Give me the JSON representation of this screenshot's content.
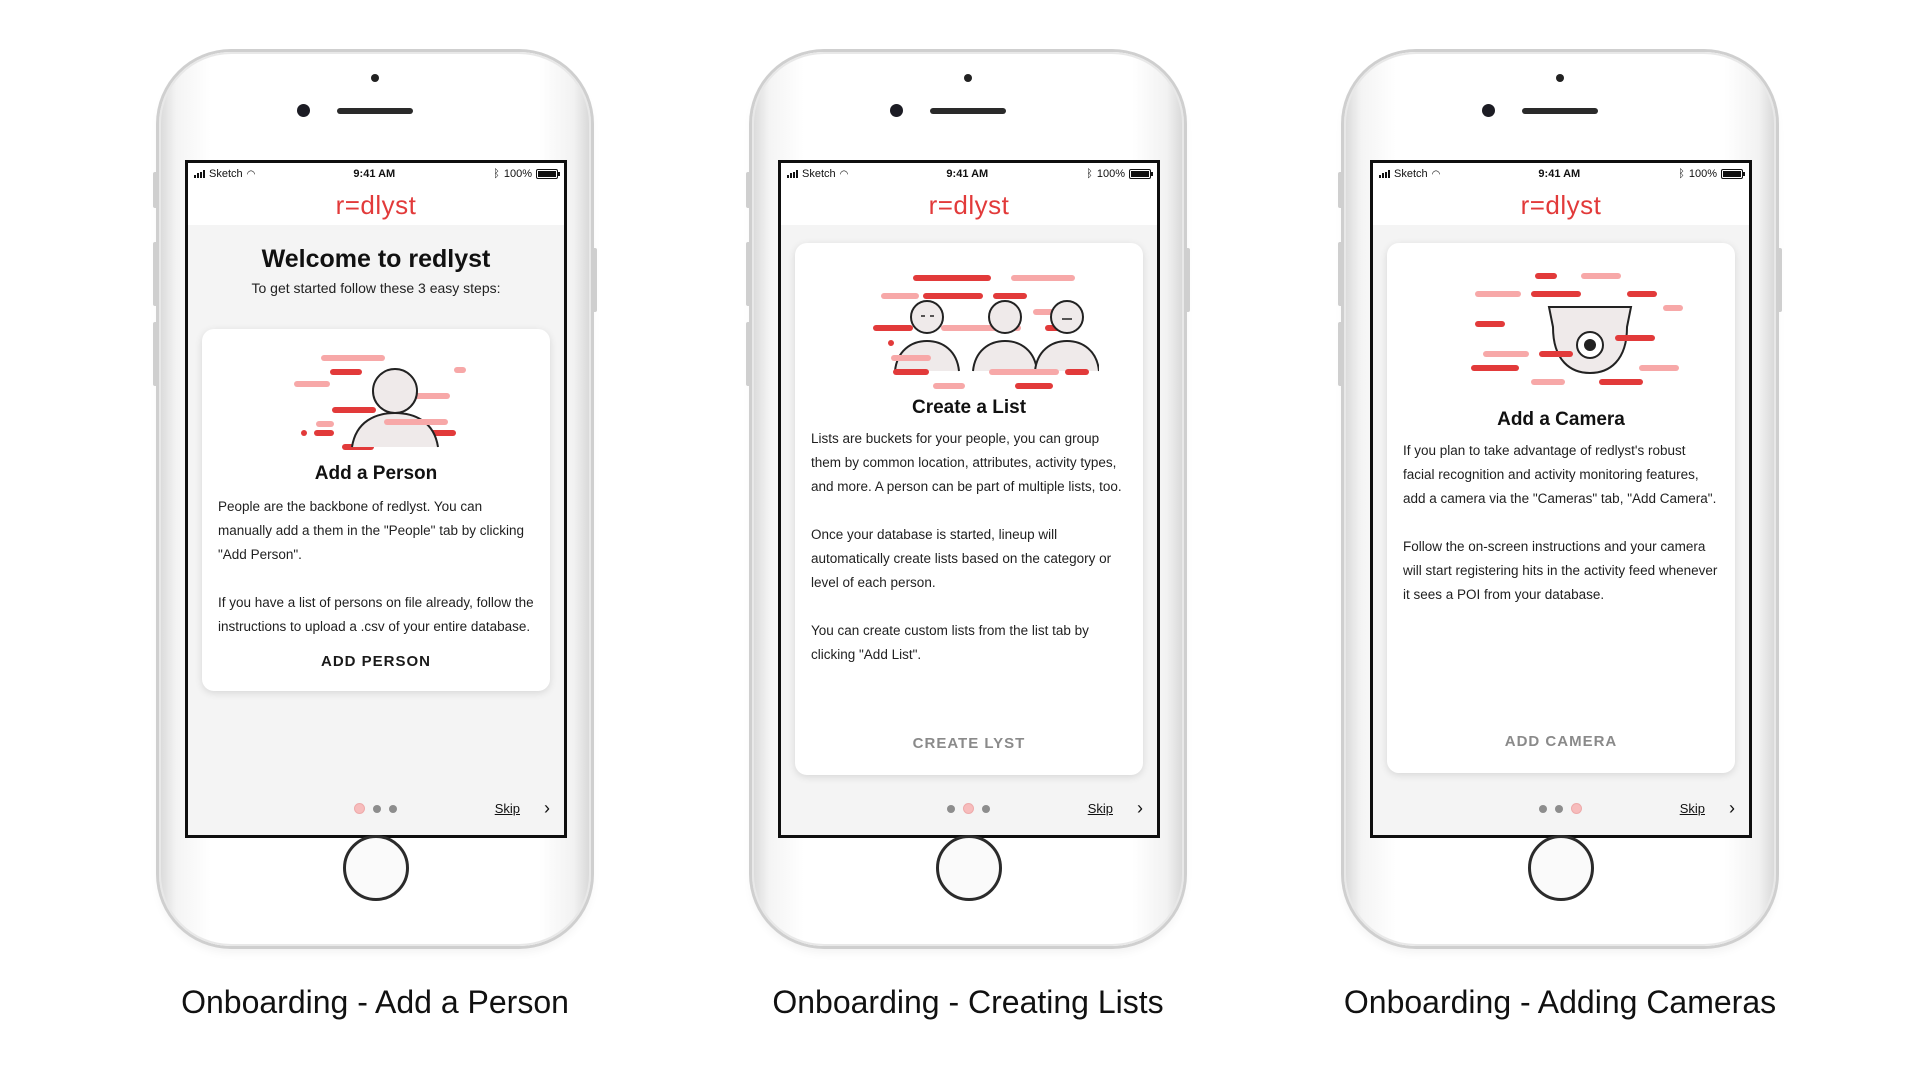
{
  "status_bar": {
    "carrier": "Sketch",
    "time": "9:41 AM",
    "battery": "100%"
  },
  "brand": "r=dlyst",
  "phones": [
    {
      "welcome_title": "Welcome to redlyst",
      "welcome_subtitle": "To get started follow these 3 easy steps:",
      "card_title": "Add a Person",
      "paragraphs": [
        "People are the backbone of redlyst.  You can manually add a them in the \"People\" tab by clicking \"Add Person\".",
        "If you have a list of persons on file already, follow the instructions to upload a .csv of your entire database."
      ],
      "action": "ADD PERSON",
      "skip": "Skip",
      "active_step": 1,
      "caption": "Onboarding - Add a Person"
    },
    {
      "card_title": "Create a List",
      "paragraphs": [
        "Lists are buckets for your people, you can group them by common location, attributes, activity types, and more.  A person can be part of multiple lists, too.",
        "Once your database is started, lineup will automatically create lists based on the category or level of each person.",
        "You can create custom lists from the list tab by clicking \"Add List\"."
      ],
      "action": "CREATE LYST",
      "skip": "Skip",
      "active_step": 2,
      "caption": "Onboarding - Creating Lists"
    },
    {
      "card_title": "Add a Camera",
      "paragraphs": [
        "If you plan to take advantage of redlyst's robust facial recognition and activity monitoring features, add a camera via the \"Cameras\" tab, \"Add Camera\".",
        "Follow the on-screen instructions and your camera will start registering hits in the activity feed whenever it sees a POI from your database."
      ],
      "action": "ADD CAMERA",
      "skip": "Skip",
      "active_step": 3,
      "caption": "Onboarding - Adding Cameras"
    }
  ],
  "icons": {
    "signal": "signal-bars-icon",
    "wifi": "wifi-icon",
    "bluetooth": "bluetooth-icon",
    "battery": "battery-icon",
    "next": "chevron-right-icon"
  },
  "colors": {
    "brand_red": "#e23a3a",
    "light_red": "#f7a8a8",
    "text": "#1a1a1a",
    "muted": "#8a8a8a"
  }
}
